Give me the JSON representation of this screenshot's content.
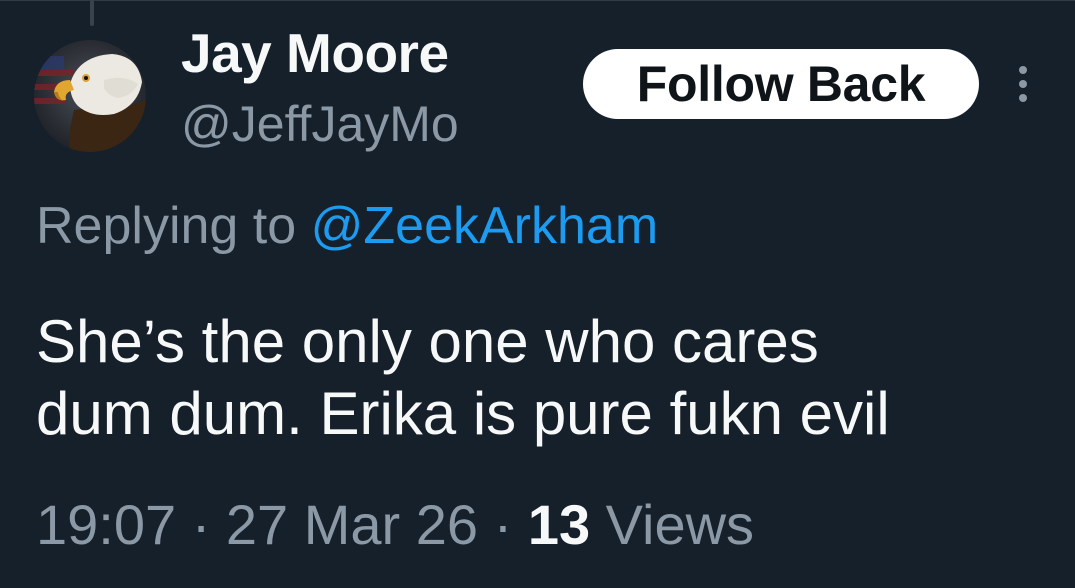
{
  "author": {
    "display_name": "Jay Moore",
    "handle": "@JeffJayMo",
    "avatar": "bald-eagle-avatar"
  },
  "actions": {
    "follow_label": "Follow Back",
    "more_icon": "more-vertical-icon"
  },
  "reply": {
    "prefix": "Replying to ",
    "mention": "@ZeekArkham"
  },
  "tweet": {
    "text_line1": "She’s the only one who cares",
    "text_line2": "dum dum. Erika is pure fukn evil"
  },
  "meta": {
    "time": "19:07",
    "separator": " · ",
    "date": "27 Mar 26",
    "views_count": "13",
    "views_label": " Views"
  },
  "colors": {
    "background": "#15202b",
    "primary_text": "#f7f9f9",
    "secondary_text": "#8b98a5",
    "link": "#1d9bf0",
    "button_bg": "#ffffff",
    "button_text": "#0f1419"
  }
}
